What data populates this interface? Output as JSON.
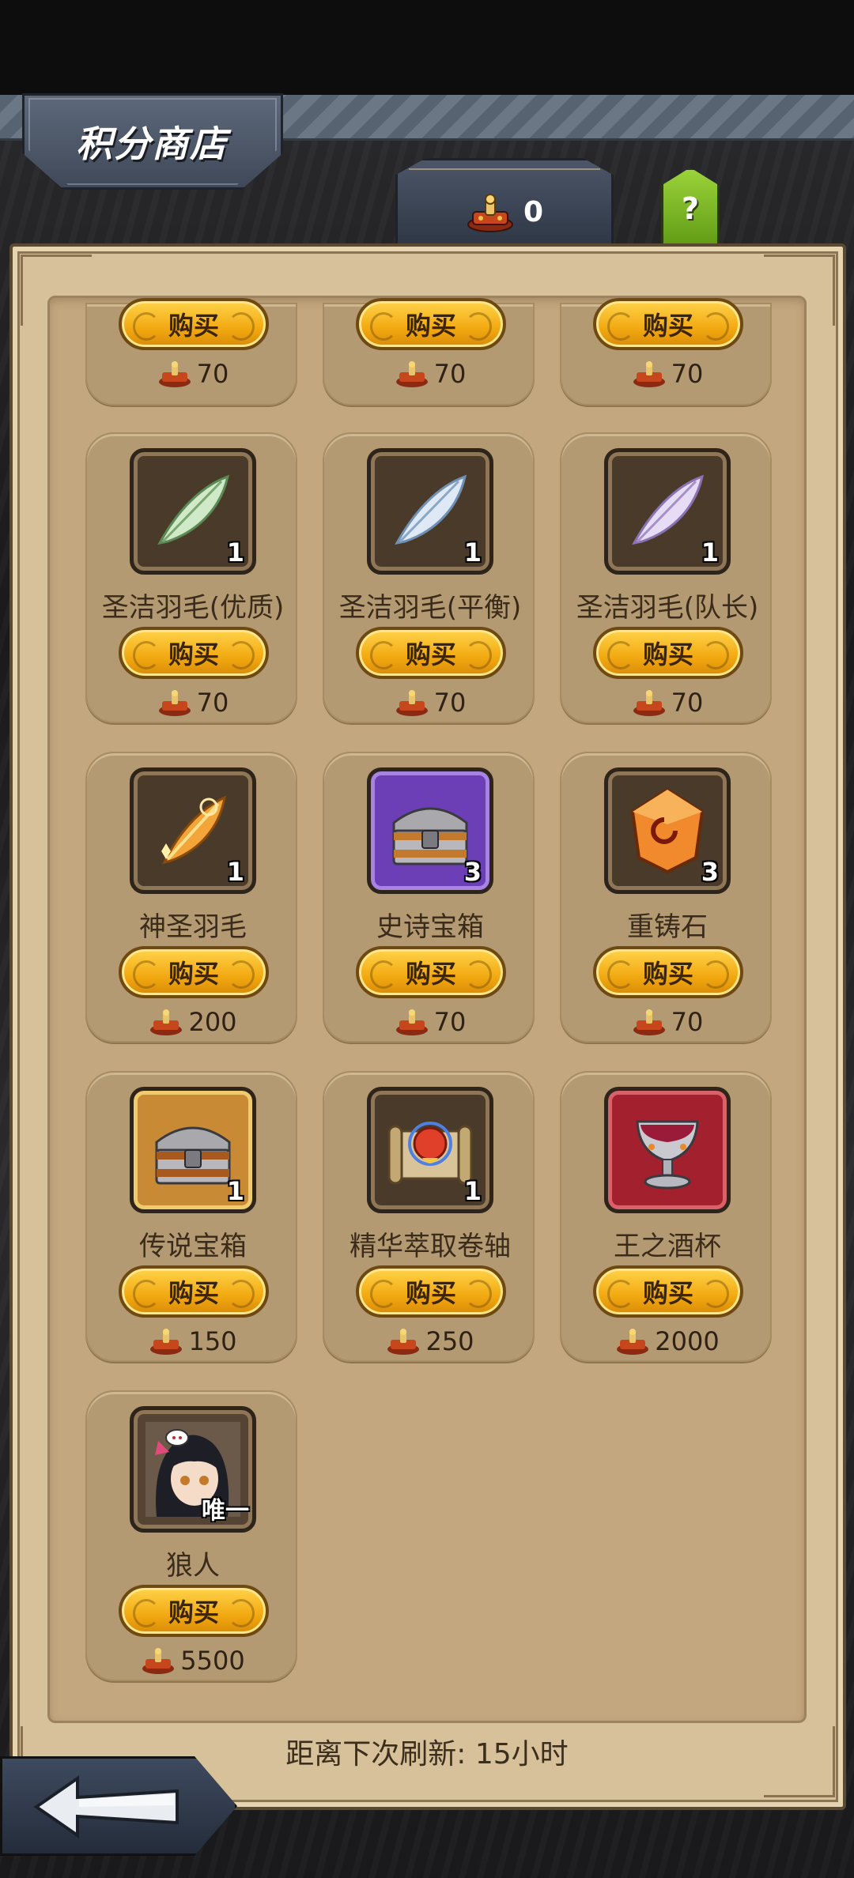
{
  "header": {
    "title": "积分商店"
  },
  "currency": {
    "icon": "crown-token-icon",
    "value": "0"
  },
  "help": {
    "label": "?"
  },
  "buy_label": "购买",
  "cut_row": [
    {
      "price": "70"
    },
    {
      "price": "70"
    },
    {
      "price": "70"
    }
  ],
  "items": [
    {
      "name": "圣洁羽毛(优质)",
      "count": "1",
      "icon": "feather-green-icon",
      "price": "70"
    },
    {
      "name": "圣洁羽毛(平衡)",
      "count": "1",
      "icon": "feather-blue-icon",
      "price": "70"
    },
    {
      "name": "圣洁羽毛(队长)",
      "count": "1",
      "icon": "feather-purple-icon",
      "price": "70"
    },
    {
      "name": "神圣羽毛",
      "count": "1",
      "icon": "holy-feather-icon",
      "price": "200"
    },
    {
      "name": "史诗宝箱",
      "count": "3",
      "icon": "epic-chest-icon",
      "price": "70"
    },
    {
      "name": "重铸石",
      "count": "3",
      "icon": "reforge-stone-icon",
      "price": "70"
    },
    {
      "name": "传说宝箱",
      "count": "1",
      "icon": "legendary-chest-icon",
      "price": "150"
    },
    {
      "name": "精华萃取卷轴",
      "count": "1",
      "icon": "essence-scroll-icon",
      "price": "250"
    },
    {
      "name": "王之酒杯",
      "count": "",
      "icon": "king-chalice-icon",
      "price": "2000"
    },
    {
      "name": "狼人",
      "count": "唯一",
      "icon": "werewolf-hero-portrait-icon",
      "price": "5500"
    }
  ],
  "footer": {
    "refresh_text": "距离下次刷新: 15小时"
  },
  "nav": {
    "back_icon": "back-arrow-icon"
  }
}
